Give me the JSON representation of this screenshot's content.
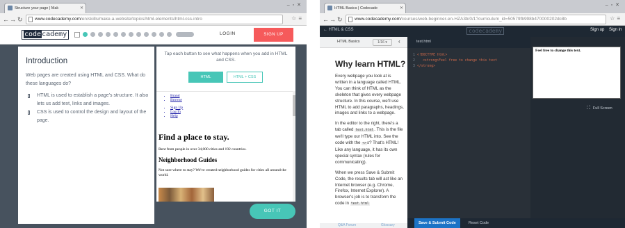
{
  "left_window": {
    "tab_title": "Structure your page | Mak",
    "url_host": "www.codecademy.com",
    "url_path": "/en/skills/make-a-website/topics/html-elements/html-css-intro",
    "logo_left": "code",
    "logo_right": "cademy",
    "login_label": "LOGIN",
    "signup_label": "SIGN UP",
    "lesson": {
      "title": "Introduction",
      "intro": "Web pages are created using HTML and CSS. What do these languages do?",
      "bullets": [
        "HTML is used to establish a page's structure. It also lets us add text, links and images.",
        "CSS is used to control the design and layout of the page."
      ]
    },
    "panel": {
      "tip": "Tap each button to see what happens when you add in HTML and CSS.",
      "btn_html": "HTML",
      "btn_html_css": "HTML + CSS"
    },
    "preview": {
      "links_top": [
        "Brand",
        "Browse"
      ],
      "links_bottom": [
        "Sign Up",
        "Log In",
        "Help"
      ],
      "heading": "Find a place to stay.",
      "subtext": "Rent from people in over 34,000 cities and 192 countries.",
      "heading2": "Neighborhood Guides",
      "paragraph": "Not sure where to stay? We've created neighborhood guides for cities all around the world."
    },
    "got_it_label": "GOT IT"
  },
  "right_window": {
    "tab_title": "HTML Basics | Codecade",
    "url_host": "www.codecademy.com",
    "url_path": "/courses/web-beginner-en-HZA3b/0/1?curriculum_id=50579fb998b470000202dc8b",
    "back_label": "HTML & CSS",
    "logo_left": "code",
    "logo_right": "cademy",
    "signup_label": "Sign up",
    "signin_label": "Sign in",
    "course_label": "HTML Basics",
    "progress_label": "1/16",
    "lesson_title": "Why learn HTML?",
    "p1": "Every webpage you look at is written in a language called HTML. You can think of HTML as the skeleton that gives every webpage structure. In this course, we'll use HTML to add paragraphs, headings, images and links to a webpage.",
    "p2_a": "In the editor to the right, there's a tab called",
    "p2_code": "test.html",
    "p2_b": ". This is the file we'll type our HTML into. See the code with the",
    "p2_code2": "<>",
    "p2_c": "s? That's HTML! Like any language, it has its own special syntax (rules for communicating).",
    "p3_a": "When we press Save & Submit Code, the results tab will act like an Internet browser (e.g. Chrome, Firefox, Internet Explorer). A browser's job is to transform the code in",
    "p3_code": "test.html",
    "editor_tab": "test.html",
    "code_lines": [
      "<!DOCTYPE html>",
      "<strong>Feel free to change this text",
      "</strong>"
    ],
    "result_text": "Feel free to change this text.",
    "full_screen_label": "Full Screen",
    "save_label": "Save & Submit Code",
    "reset_label": "Reset Code",
    "forum_label": "Q&A Forum",
    "glossary_label": "Glossary"
  },
  "colors": {
    "accent": "#47c6b7",
    "signup_red": "#f65a5b",
    "stage": "#47525e",
    "dark_bar": "#1e2833",
    "save_blue": "#1c73c6"
  }
}
